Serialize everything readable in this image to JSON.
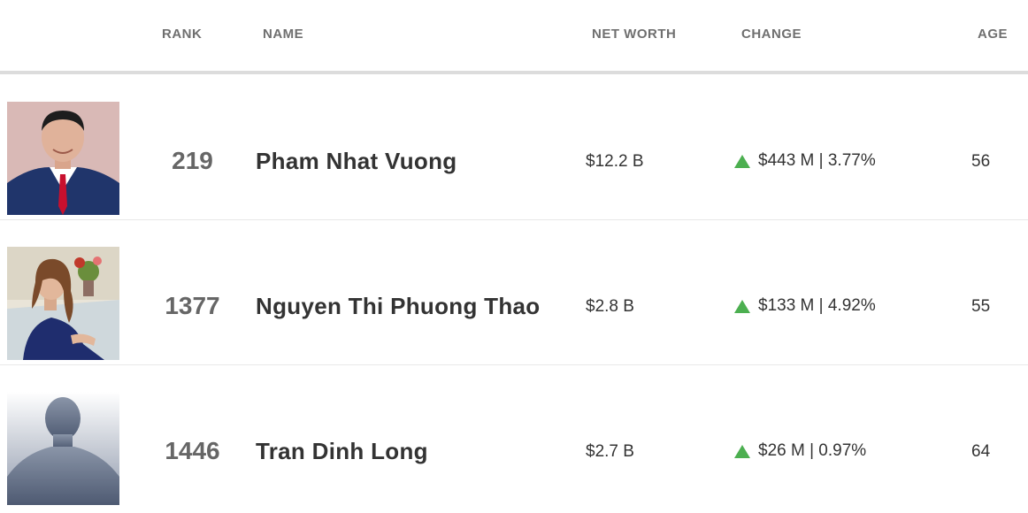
{
  "header": {
    "rank": "RANK",
    "name": "NAME",
    "net_worth": "NET WORTH",
    "change": "CHANGE",
    "age": "AGE"
  },
  "rows": [
    {
      "rank": "219",
      "name": "Pham Nhat Vuong",
      "net_worth": "$12.2 B",
      "change": "$443 M | 3.77%",
      "age": "56",
      "change_direction": "up",
      "photo": "man-in-suit-portrait"
    },
    {
      "rank": "1377",
      "name": "Nguyen Thi Phuong Thao",
      "net_worth": "$2.8 B",
      "change": "$133 M | 4.92%",
      "age": "55",
      "change_direction": "up",
      "photo": "woman-portrait"
    },
    {
      "rank": "1446",
      "name": "Tran Dinh Long",
      "net_worth": "$2.7 B",
      "change": "$26 M | 0.97%",
      "age": "64",
      "change_direction": "up",
      "photo": "placeholder-silhouette"
    }
  ],
  "colors": {
    "up_arrow": "#4caf50",
    "header_text": "#6f6f6f",
    "rank_text": "#666666"
  }
}
